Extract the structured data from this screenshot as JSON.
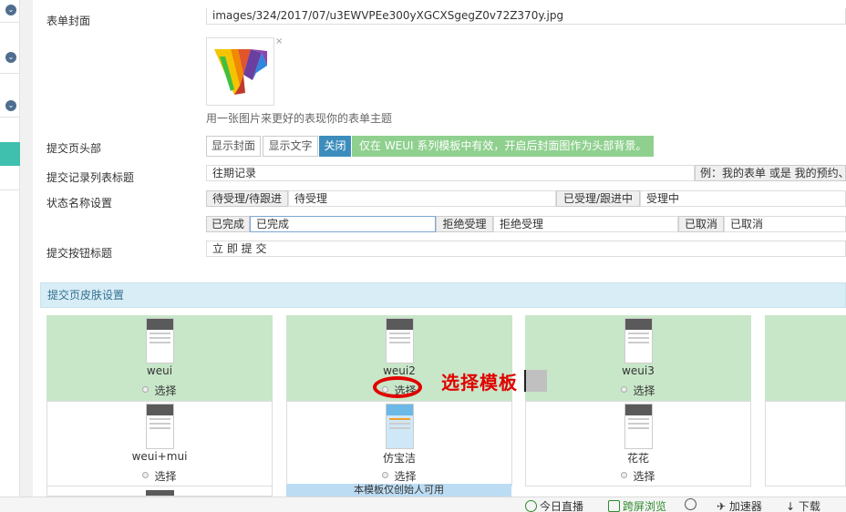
{
  "form": {
    "cover_label": "表单封面",
    "cover_path": "images/324/2017/07/u3EWVPEe300yXGCXSgegZ0v72Z370y.jpg",
    "cover_close": "×",
    "cover_hint": "用一张图片来更好的表现你的表单主题",
    "header_label": "提交页头部",
    "header_options": [
      "显示封面",
      "显示文字",
      "关闭"
    ],
    "header_active": "关闭",
    "header_hint": "仅在 WEUI 系列模板中有效，开启后封面图作为头部背景。",
    "list_title_label": "提交记录列表标题",
    "list_title_value": "往期记录",
    "list_title_example": "例：我的表单 或是 我的预约、",
    "status_label": "状态名称设置",
    "status": [
      {
        "addon": "待受理/待跟进",
        "value": "待受理"
      },
      {
        "addon": "已受理/跟进中",
        "value": "受理中"
      },
      {
        "addon": "已完成",
        "value": "已完成"
      },
      {
        "addon": "拒绝受理",
        "value": "拒绝受理"
      },
      {
        "addon": "已取消",
        "value": "已取消"
      }
    ],
    "submit_label": "提交按钮标题",
    "submit_value": "立 即 提 交"
  },
  "skin": {
    "section_title": "提交页皮肤设置",
    "pick_label": "选择",
    "templates": [
      {
        "name": "weui"
      },
      {
        "name": "weui2"
      },
      {
        "name": "weui3"
      },
      {
        "name": "weui+mui"
      },
      {
        "name": "仿宝洁"
      },
      {
        "name": "花花"
      }
    ],
    "partial_note": "本模板仅创始人可用"
  },
  "annotation": {
    "text": "选择模板",
    "color": "#e10000"
  },
  "statusbar": {
    "items": [
      "今日直播",
      "跨屏浏览",
      "加速器",
      "下载"
    ]
  },
  "colors": {
    "accent": "#3c8dbc",
    "selected_bg": "#c8e7c9",
    "hint_green": "#8fd08f",
    "section_bg": "#d9edf7",
    "rail_active": "#3fbfae"
  }
}
